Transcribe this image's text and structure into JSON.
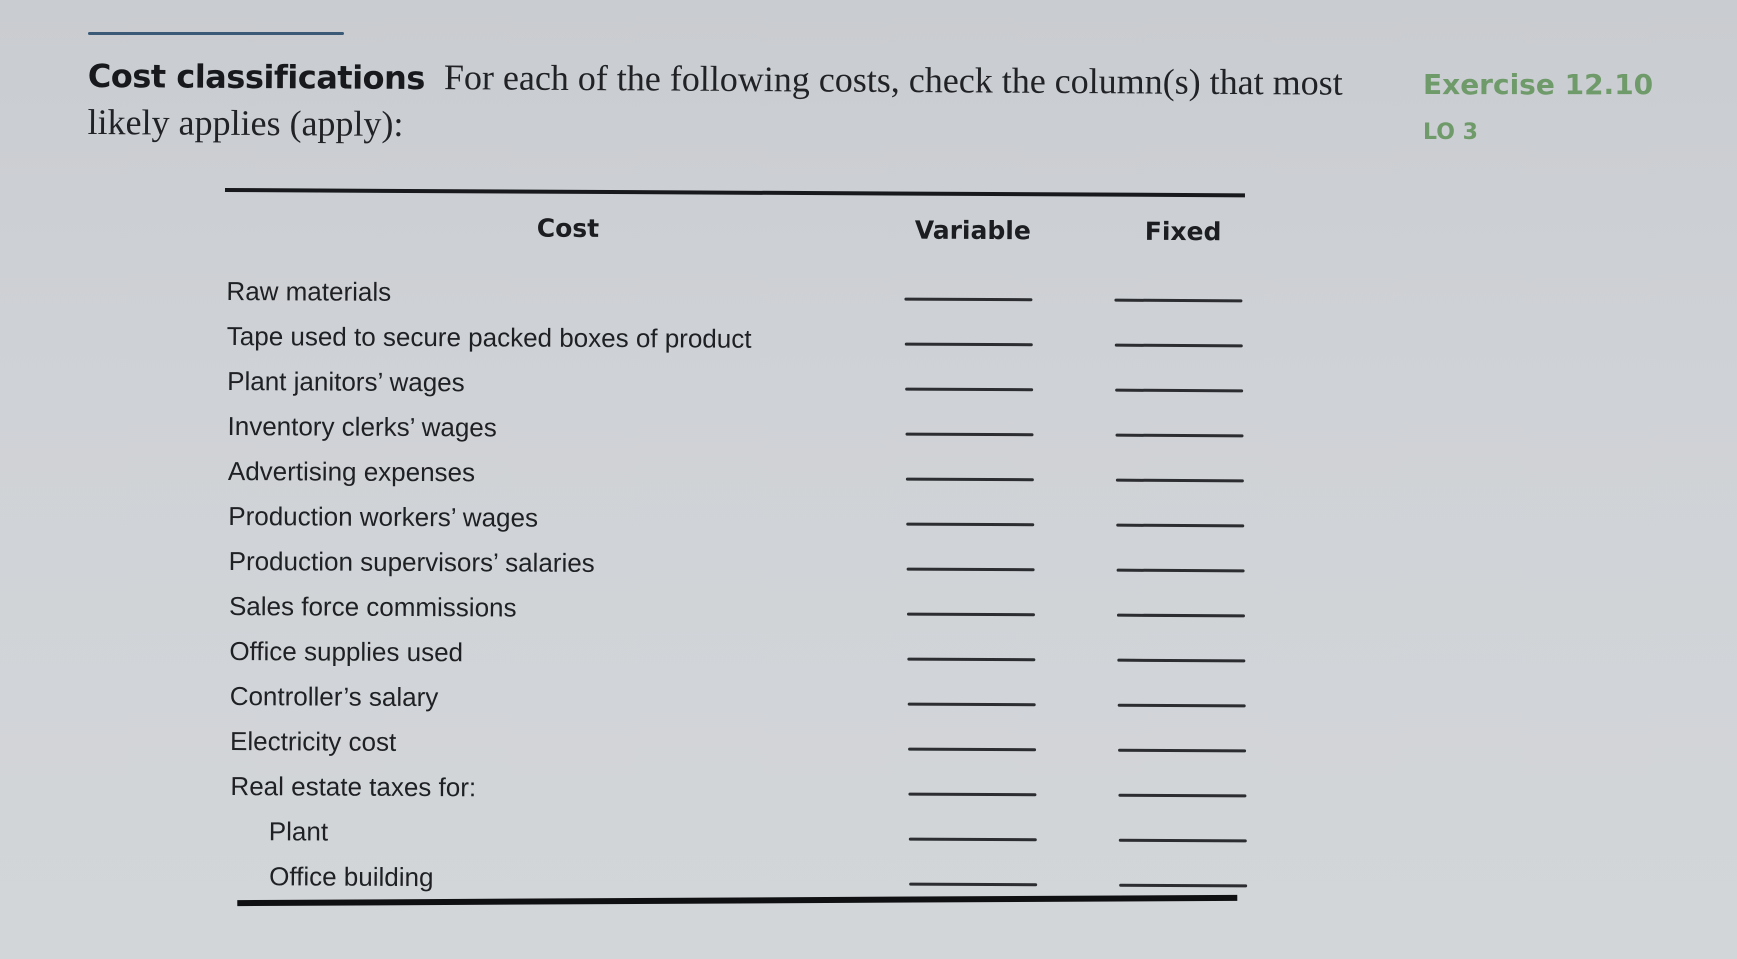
{
  "exercise": {
    "title": "Cost classifications",
    "instruction": "For each of the following costs, check the column(s) that most likely applies (apply):",
    "label": "Exercise 12.10",
    "learning_objective": "LO 3"
  },
  "table": {
    "headers": {
      "cost": "Cost",
      "variable": "Variable",
      "fixed": "Fixed"
    },
    "rows": [
      {
        "label": "Raw materials",
        "indent": false,
        "variable": "",
        "fixed": ""
      },
      {
        "label": "Tape used to secure packed boxes of product",
        "indent": false,
        "variable": "",
        "fixed": ""
      },
      {
        "label": "Plant janitors’ wages",
        "indent": false,
        "variable": "",
        "fixed": ""
      },
      {
        "label": "Inventory clerks’ wages",
        "indent": false,
        "variable": "",
        "fixed": ""
      },
      {
        "label": "Advertising expenses",
        "indent": false,
        "variable": "",
        "fixed": ""
      },
      {
        "label": "Production workers’ wages",
        "indent": false,
        "variable": "",
        "fixed": ""
      },
      {
        "label": "Production supervisors’ salaries",
        "indent": false,
        "variable": "",
        "fixed": ""
      },
      {
        "label": "Sales force commissions",
        "indent": false,
        "variable": "",
        "fixed": ""
      },
      {
        "label": "Office supplies used",
        "indent": false,
        "variable": "",
        "fixed": ""
      },
      {
        "label": "Controller’s salary",
        "indent": false,
        "variable": "",
        "fixed": ""
      },
      {
        "label": "Electricity cost",
        "indent": false,
        "variable": "",
        "fixed": ""
      },
      {
        "label": "Real estate taxes for:",
        "indent": false,
        "variable": "",
        "fixed": ""
      },
      {
        "label": "Plant",
        "indent": true,
        "variable": "",
        "fixed": ""
      },
      {
        "label": "Office building",
        "indent": true,
        "variable": "",
        "fixed": ""
      }
    ]
  }
}
